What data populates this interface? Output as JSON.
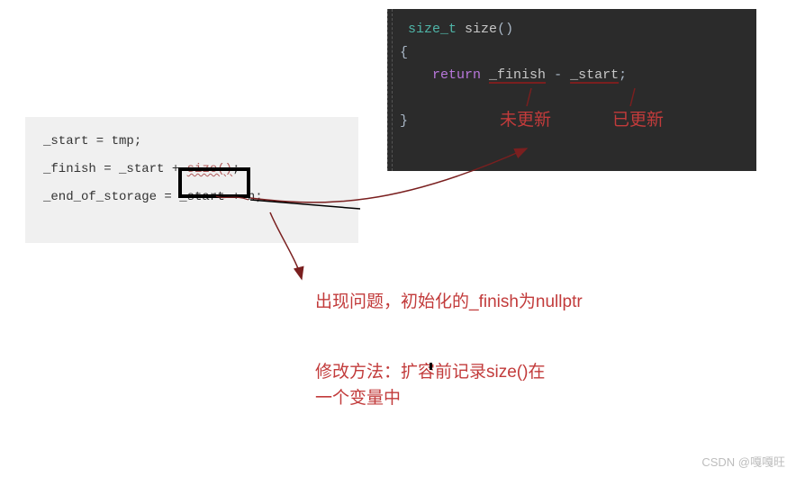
{
  "light_code": {
    "line1": "_start = tmp;",
    "line2_pre": "_finish = _start + ",
    "line2_size": "size()",
    "line2_post": ";",
    "line3": "_end_of_storage = _start + n;"
  },
  "dark_code": {
    "type": "size_t",
    "fn": "size",
    "paren": "()",
    "brace_open": "{",
    "ret": "return",
    "finish": "_finish",
    "op": " - ",
    "start": "_start",
    "semi": ";",
    "brace_close": "}"
  },
  "notes": {
    "not_updated": "未更新",
    "updated": "已更新",
    "problem": "出现问题，初始化的_finish为nullptr",
    "fix": "修改方法：扩容前记录size()在一个变量中"
  },
  "watermark": "CSDN @嘎嘎旺"
}
